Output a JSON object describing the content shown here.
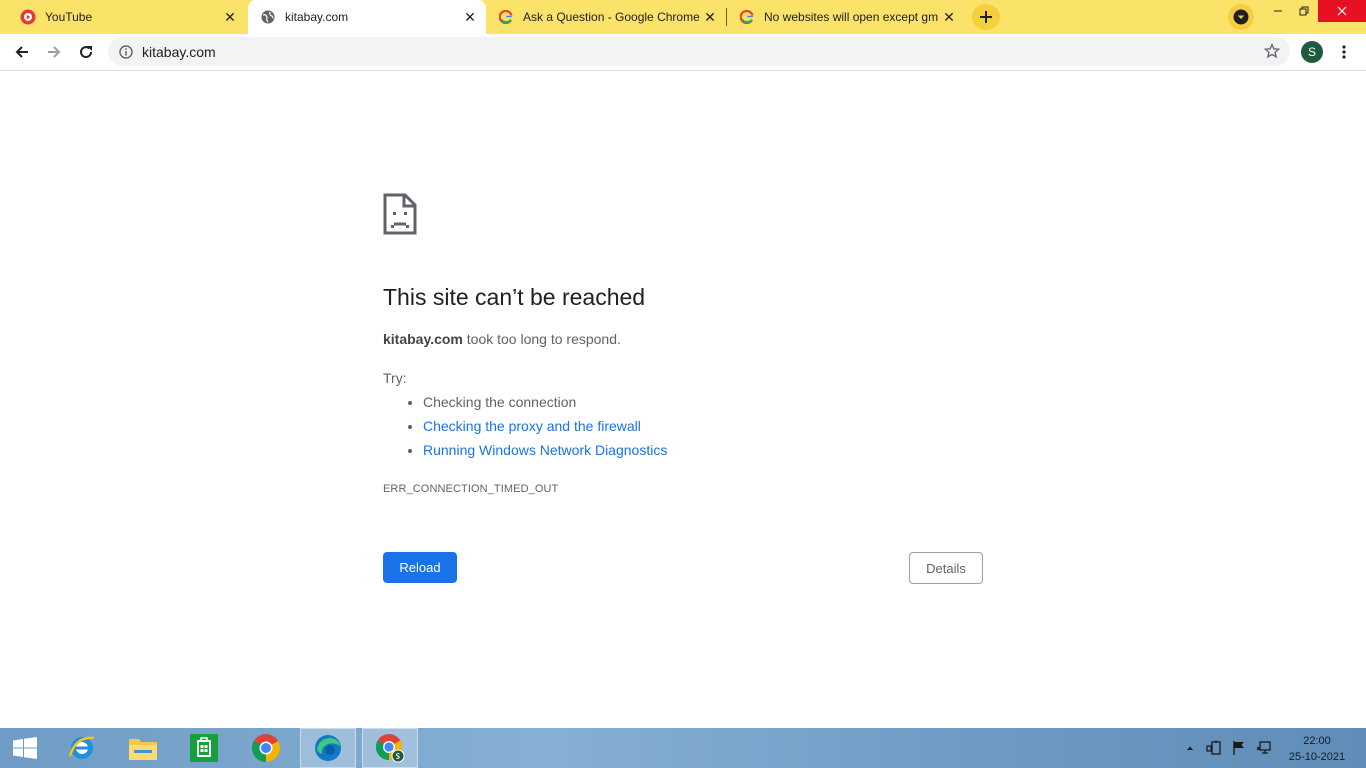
{
  "tabs": [
    {
      "title": "YouTube",
      "icon": "youtube-icon"
    },
    {
      "title": "kitabay.com",
      "icon": "globe-icon"
    },
    {
      "title": "Ask a Question - Google Chrome",
      "icon": "google-icon"
    },
    {
      "title": "No websites will open except gm",
      "icon": "google-icon"
    }
  ],
  "toolbar": {
    "url": "kitabay.com",
    "avatar_letter": "S"
  },
  "error": {
    "title": "This site can’t be reached",
    "host": "kitabay.com",
    "message": " took too long to respond.",
    "try_label": "Try:",
    "suggestions": [
      "Checking the connection",
      "Checking the proxy and the firewall",
      "Running Windows Network Diagnostics"
    ],
    "code": "ERR_CONNECTION_TIMED_OUT",
    "reload_label": "Reload",
    "details_label": "Details"
  },
  "taskbar": {
    "time": "22:00",
    "date": "25-10-2021",
    "apps": [
      "start-icon",
      "internet-explorer-icon",
      "file-explorer-icon",
      "store-icon",
      "chrome-icon",
      "edge-icon",
      "chrome-profile-icon"
    ]
  },
  "colors": {
    "tabstrip": "#fbe36a",
    "link": "#1a73e8",
    "reload_button": "#1a73e8"
  }
}
